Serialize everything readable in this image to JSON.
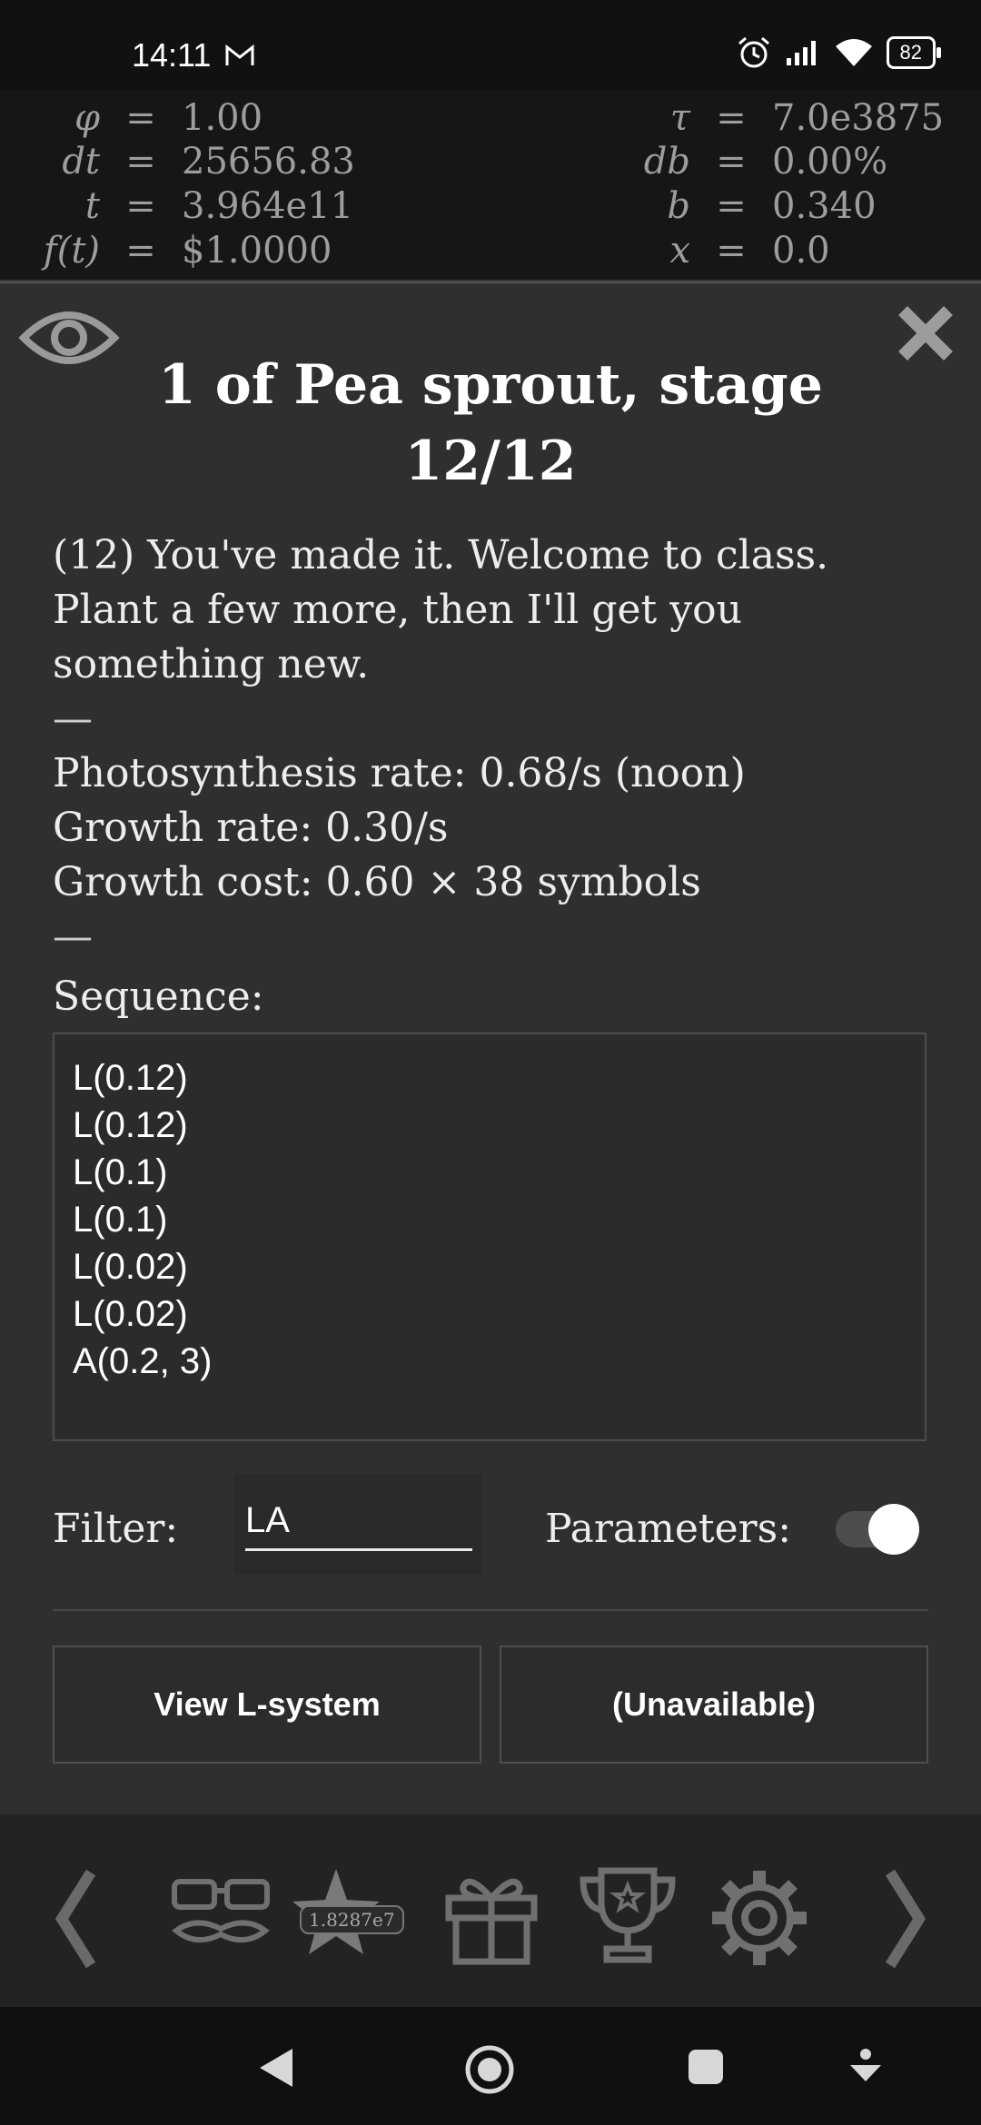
{
  "status_bar": {
    "time": "14:11",
    "battery": "82"
  },
  "variables": {
    "left": [
      {
        "name": "φ",
        "value": "1.00"
      },
      {
        "name": "dt",
        "value": "25656.83"
      },
      {
        "name": "t",
        "value": "3.964e11"
      },
      {
        "name": "f(t)",
        "value": "$1.0000"
      }
    ],
    "right": [
      {
        "name": "τ",
        "value": "7.0e3875"
      },
      {
        "name": "db",
        "value": "0.00%"
      },
      {
        "name": "b",
        "value": "0.340"
      },
      {
        "name": "x",
        "value": "0.0"
      }
    ]
  },
  "panel": {
    "title": "1 of Pea sprout, stage 12/12",
    "description": "(12) You've made it. Welcome to class. Plant a few more, then I'll get you something new.",
    "dash": "—",
    "stats": [
      "Photosynthesis rate: 0.68/s (noon)",
      "Growth rate: 0.30/s",
      "Growth cost: 0.60 × 38 symbols"
    ],
    "sequence_label": "Sequence:",
    "sequence": [
      "L(0.12)",
      "L(0.12)",
      "L(0.1)",
      "L(0.1)",
      "L(0.02)",
      "L(0.02)",
      "A(0.2, 3)"
    ],
    "filter_label": "Filter:",
    "filter_value": "LA",
    "parameters_label": "Parameters:",
    "parameters_on": true,
    "button_left": "View L-system",
    "button_right": "(Unavailable)"
  },
  "bottom_bar": {
    "star_badge": "1.8287e7",
    "items": [
      "chevron-left-icon",
      "disguise-icon",
      "star-icon",
      "gift-icon",
      "trophy-icon",
      "gear-icon",
      "chevron-right-icon"
    ]
  }
}
